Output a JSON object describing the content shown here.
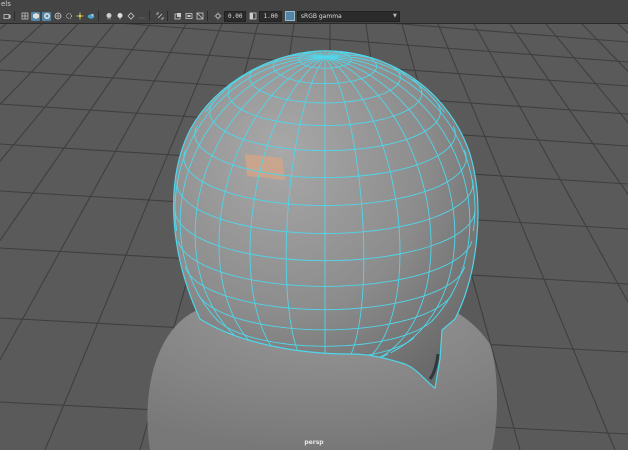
{
  "menubar": {
    "title": "els"
  },
  "toolbar": {
    "icons": [
      "camera-icon",
      "grid-icon",
      "shaded-icon",
      "textured-icon",
      "xray-icon",
      "lights-icon",
      "shadow-icon",
      "isolate-icon",
      "render-icon",
      "ao-icon",
      "motion-blur-icon",
      "aa-icon",
      "wireframe-icon",
      "resolution-gate-icon",
      "film-gate-icon",
      "safe-area-icon",
      "exposure-icon",
      "gamma-icon"
    ],
    "exposure_value": "0.00",
    "gamma_value": "1.00",
    "color_space": "sRGB gamma"
  },
  "viewport": {
    "camera": "persp",
    "colors": {
      "background": "#5a5a5a",
      "grid": "#3c3c3c",
      "wireframe": "#4fd6ea",
      "selected_face": "#d7a586"
    }
  }
}
